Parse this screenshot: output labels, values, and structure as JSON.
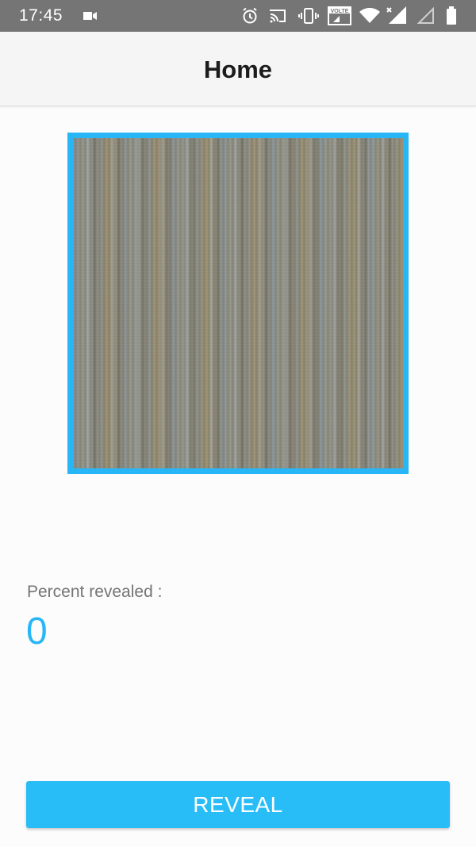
{
  "status_bar": {
    "time": "17:45",
    "icons": [
      "video-camera-icon",
      "alarm-icon",
      "cast-icon",
      "vibrate-icon",
      "volte-icon",
      "wifi-icon",
      "signal-icon",
      "signal-empty-icon",
      "battery-icon"
    ],
    "volte_label": "VOLTE"
  },
  "app_bar": {
    "title": "Home"
  },
  "scratch_card": {
    "border_color": "#29b6f6"
  },
  "progress": {
    "label": "Percent revealed :",
    "value": "0"
  },
  "actions": {
    "reveal_label": "REVEAL"
  },
  "colors": {
    "accent": "#29b6f6",
    "status_bar": "#757575",
    "app_bar": "#f5f5f5"
  }
}
